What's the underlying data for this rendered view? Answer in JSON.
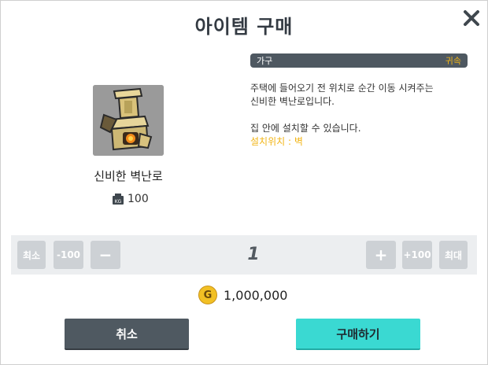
{
  "dialog": {
    "title": "아이템 구매"
  },
  "item": {
    "name": "신비한 벽난로",
    "weight_icon": "kg-weight-icon",
    "weight": "100",
    "category": "가구",
    "bind_type": "귀속",
    "description_line1": "주택에 들어오기 전 위치로 순간 이동 시켜주는",
    "description_line2": "신비한 벽난로입니다.",
    "description_line3": "집 안에 설치할 수 있습니다.",
    "placement": "설치위치 : 벽"
  },
  "quantity": {
    "min_label": "최소",
    "minus100_label": "-100",
    "minus_label": "−",
    "value": "1",
    "plus_label": "+",
    "plus100_label": "+100",
    "max_label": "최대"
  },
  "price": {
    "coin_icon": "gold-coin-icon",
    "coin_letter": "G",
    "amount": "1,000,000"
  },
  "actions": {
    "cancel_label": "취소",
    "buy_label": "구매하기"
  },
  "colors": {
    "accent": "#3ad9d2",
    "dark": "#4f5961",
    "highlight": "#f2b516"
  }
}
